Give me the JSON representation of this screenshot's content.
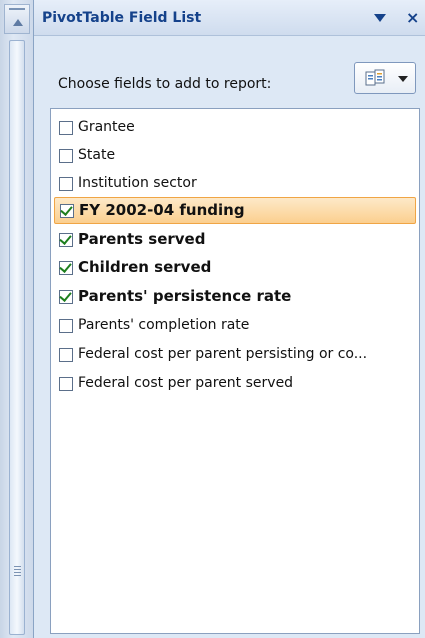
{
  "panel": {
    "title": "PivotTable Field List",
    "dropdown_icon": "dropdown-triangle-icon",
    "close_icon": "close-x-icon",
    "choose_label": "Choose fields to add to report:",
    "layout_button_icon": "field-layout-icon"
  },
  "fields": [
    {
      "label": "Grantee",
      "checked": false,
      "bold": false,
      "active": false
    },
    {
      "label": "State",
      "checked": false,
      "bold": false,
      "active": false
    },
    {
      "label": "Institution sector",
      "checked": false,
      "bold": false,
      "active": false
    },
    {
      "label": "FY 2002-04 funding",
      "checked": true,
      "bold": true,
      "active": true
    },
    {
      "label": "Parents served",
      "checked": true,
      "bold": true,
      "active": false
    },
    {
      "label": "Children served",
      "checked": true,
      "bold": true,
      "active": false
    },
    {
      "label": "Parents' persistence rate",
      "checked": true,
      "bold": true,
      "active": false
    },
    {
      "label": "Parents' completion rate",
      "checked": false,
      "bold": false,
      "active": false
    },
    {
      "label": "Federal cost per parent persisting or co...",
      "checked": false,
      "bold": false,
      "active": false
    },
    {
      "label": "Federal cost per parent served",
      "checked": false,
      "bold": false,
      "active": false
    }
  ],
  "colors": {
    "title": "#15428b",
    "highlight": "#fbcf8f",
    "check": "#1e7f1e"
  }
}
